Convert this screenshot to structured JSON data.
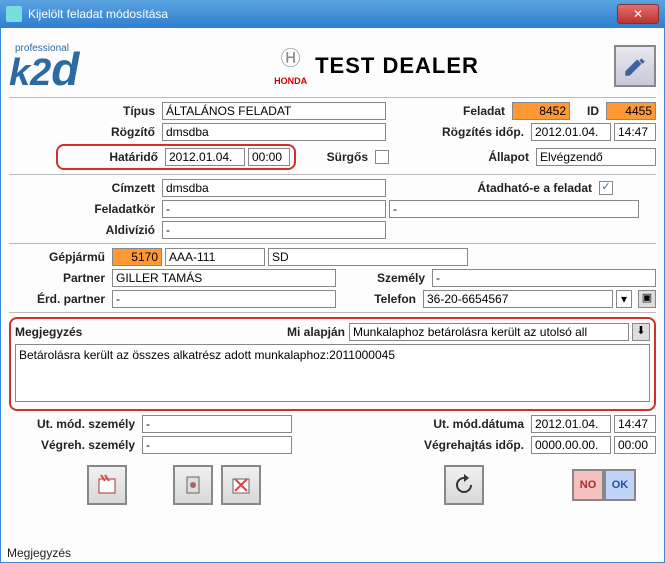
{
  "window": {
    "title": "Kijelölt feladat módosítása"
  },
  "header": {
    "prof": "professional",
    "dealer": "TEST DEALER",
    "brand": "HONDA"
  },
  "labels": {
    "tipus": "Típus",
    "feladat": "Feladat",
    "id": "ID",
    "rogzito": "Rögzítő",
    "rogz_idop": "Rögzítés időp.",
    "hatarido": "Határidő",
    "surgos": "Sürgős",
    "allapot": "Állapot",
    "cimzett": "Címzett",
    "athadhato": "Átadható-e a feladat",
    "feladatkor": "Feladatkör",
    "aldivizio": "Aldivízió",
    "gepjarmu": "Gépjármű",
    "partner": "Partner",
    "szemely": "Személy",
    "erd_partner": "Érd. partner",
    "telefon": "Telefon",
    "megjegyzes": "Megjegyzés",
    "mi_alapjan": "Mi alapján",
    "ut_mod_szemely": "Ut. mód. személy",
    "ut_mod_datuma": "Ut. mód.dátuma",
    "vegreh_szemely": "Végreh. személy",
    "vegreh_idop": "Végrehajtás időp."
  },
  "vals": {
    "tipus": "ÁLTALÁNOS FELADAT",
    "feladat_id": "8452",
    "id": "4455",
    "rogzito": "dmsdba",
    "rogz_date": "2012.01.04.",
    "rogz_time": "14:47",
    "hatar_date": "2012.01.04.",
    "hatar_time": "00:00",
    "allapot": "Elvégzendő",
    "cimzett": "dmsdba",
    "feladatkor1": "-",
    "feladatkor2": "-",
    "aldivizio": "-",
    "gepjarmu_id": "5170",
    "gepjarmu_plate": "AAA-111",
    "gepjarmu_extra": "SD",
    "partner": "GILLER TAMÁS",
    "szemely": "-",
    "erd_partner": "-",
    "telefon": "36-20-6654567",
    "mi_alapjan": "Munkalaphoz betárolásra került az utolsó all",
    "notes": "Betárolásra került az összes alkatrész adott munkalaphoz:2011000045",
    "ut_mod_szemely": "-",
    "ut_mod_date": "2012.01.04.",
    "ut_mod_time": "14:47",
    "vegreh_szemely": "-",
    "vegreh_date": "0000.00.00.",
    "vegreh_time": "00:00"
  },
  "btns": {
    "no": "NO",
    "ok": "OK"
  },
  "status": "Megjegyzés"
}
